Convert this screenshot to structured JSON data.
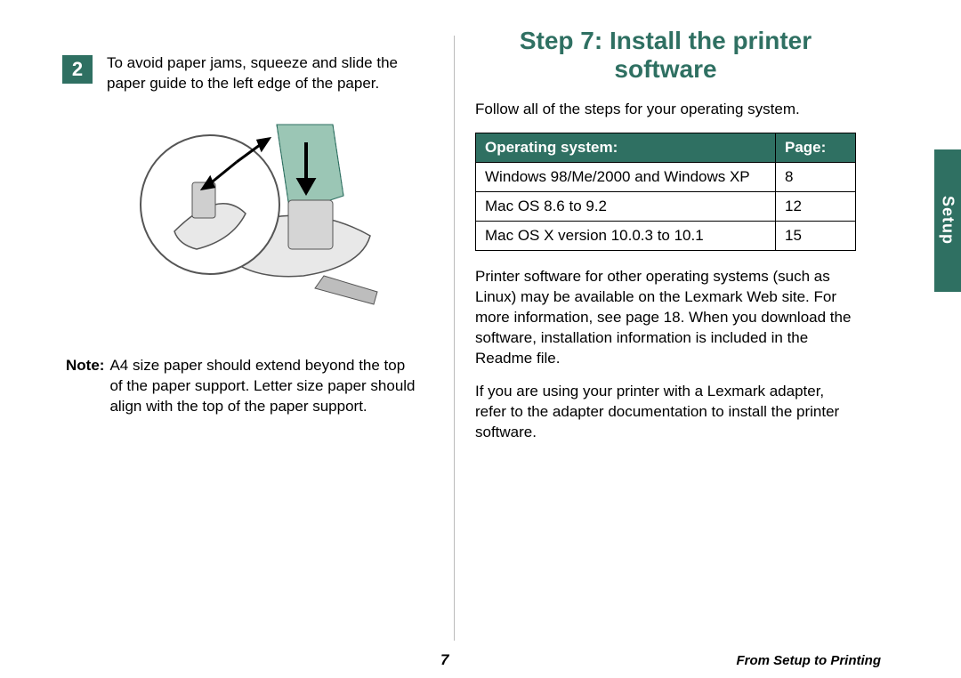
{
  "left": {
    "step_number": "2",
    "step_text": "To avoid paper jams, squeeze and slide the paper guide to the left edge of the paper.",
    "note_label": "Note:",
    "note_text": "A4 size paper should extend beyond the top of the paper support. Letter size paper should align with the top of the paper support."
  },
  "right": {
    "heading_prefix": "Step 7:",
    "heading_rest": "Install the printer software",
    "intro": "Follow all of the steps for your operating system.",
    "table": {
      "header_os": "Operating system:",
      "header_page": "Page:",
      "rows": [
        {
          "os": "Windows 98/Me/2000 and Windows XP",
          "page": "8"
        },
        {
          "os": "Mac OS 8.6 to 9.2",
          "page": "12"
        },
        {
          "os": "Mac OS X version 10.0.3 to 10.1",
          "page": "15"
        }
      ]
    },
    "para1": "Printer software for other operating systems (such as Linux) may be available on the Lexmark Web site. For more information, see page 18. When you download the software, installation information is included in the Readme file.",
    "para2": "If you are using your printer with a Lexmark adapter, refer to the adapter documentation to install the printer software."
  },
  "side_tab": "Setup",
  "footer": {
    "page_number": "7",
    "right_text": "From Setup to Printing"
  }
}
